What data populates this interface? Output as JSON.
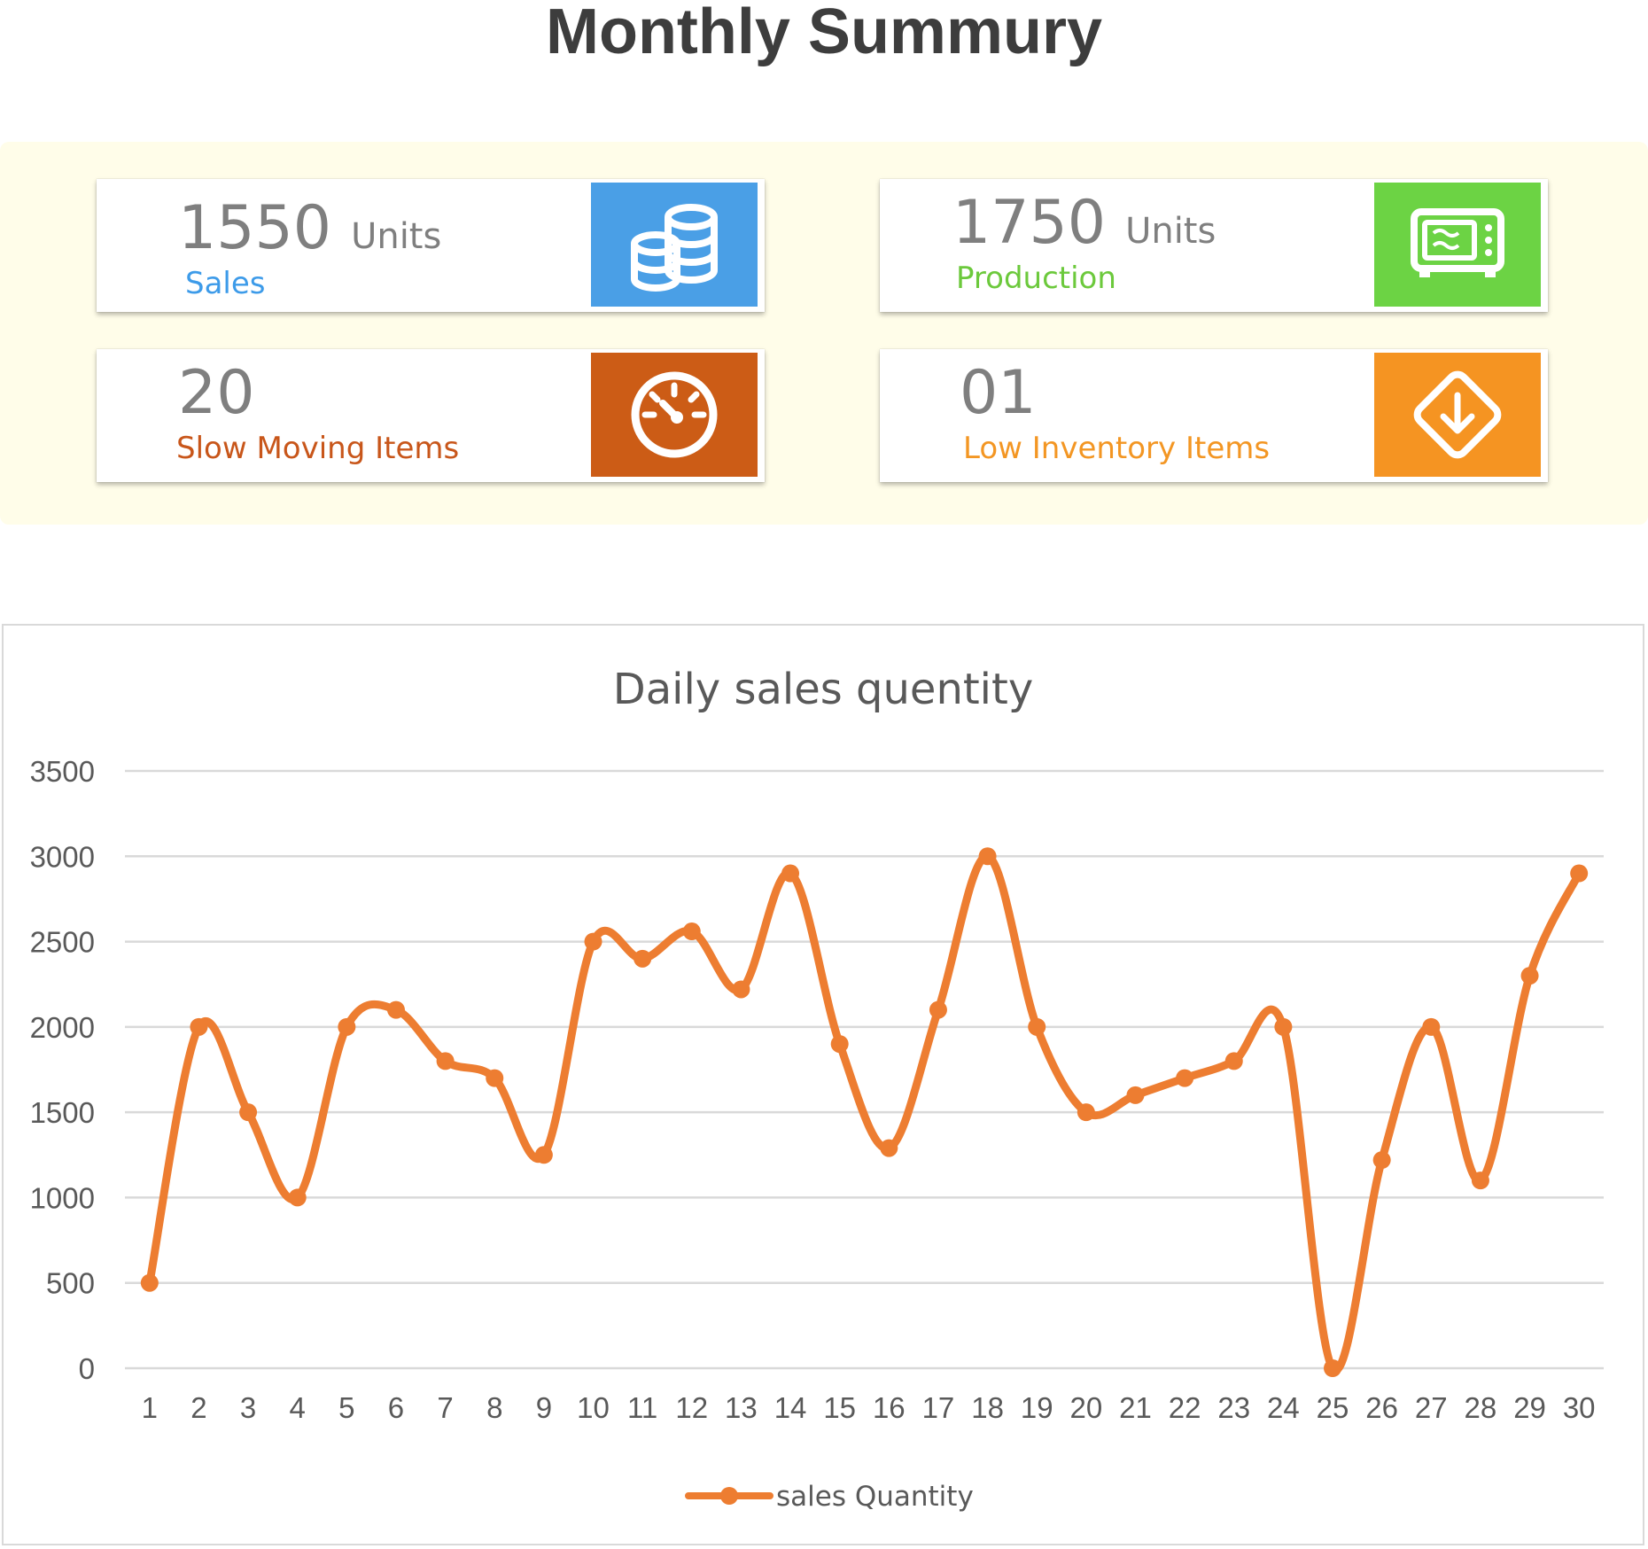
{
  "page": {
    "title": "Monthly Summury"
  },
  "kpis": [
    {
      "value": "1550",
      "unit": "Units",
      "label": "Sales",
      "label_color": "#3d9be9",
      "tile_color": "#4a9fe6",
      "icon": "coins-stack-icon"
    },
    {
      "value": "1750",
      "unit": "Units",
      "label": "Production",
      "label_color": "#6cc93c",
      "tile_color": "#6cd344",
      "icon": "microwave-icon"
    },
    {
      "value": "20",
      "unit": "",
      "label": "Slow Moving Items",
      "label_color": "#c8561a",
      "tile_color": "#cc5c16",
      "icon": "speedometer-icon"
    },
    {
      "value": "01",
      "unit": "",
      "label": "Low Inventory Items",
      "label_color": "#f39623",
      "tile_color": "#f59422",
      "icon": "download-diamond-icon"
    }
  ],
  "chart_data": {
    "type": "line",
    "title": "Daily sales quentity",
    "xlabel": "",
    "ylabel": "",
    "categories": [
      "1",
      "2",
      "3",
      "4",
      "5",
      "6",
      "7",
      "8",
      "9",
      "10",
      "11",
      "12",
      "13",
      "14",
      "15",
      "16",
      "17",
      "18",
      "19",
      "20",
      "21",
      "22",
      "23",
      "24",
      "25",
      "26",
      "27",
      "28",
      "29",
      "30"
    ],
    "series": [
      {
        "name": "sales Quantity",
        "color": "#ed7d31",
        "values": [
          500,
          2000,
          1500,
          1000,
          2000,
          2100,
          1800,
          1700,
          1250,
          2500,
          2400,
          2560,
          2220,
          2900,
          1900,
          1290,
          2100,
          3000,
          2000,
          1500,
          1600,
          1700,
          1800,
          2000,
          0,
          1220,
          2000,
          1100,
          2300,
          2900
        ]
      }
    ],
    "ylim": [
      0,
      3500
    ],
    "yticks": [
      0,
      500,
      1000,
      1500,
      2000,
      2500,
      3000,
      3500
    ],
    "smooth": true,
    "markers": true,
    "grid": true,
    "legend": "bottom"
  }
}
